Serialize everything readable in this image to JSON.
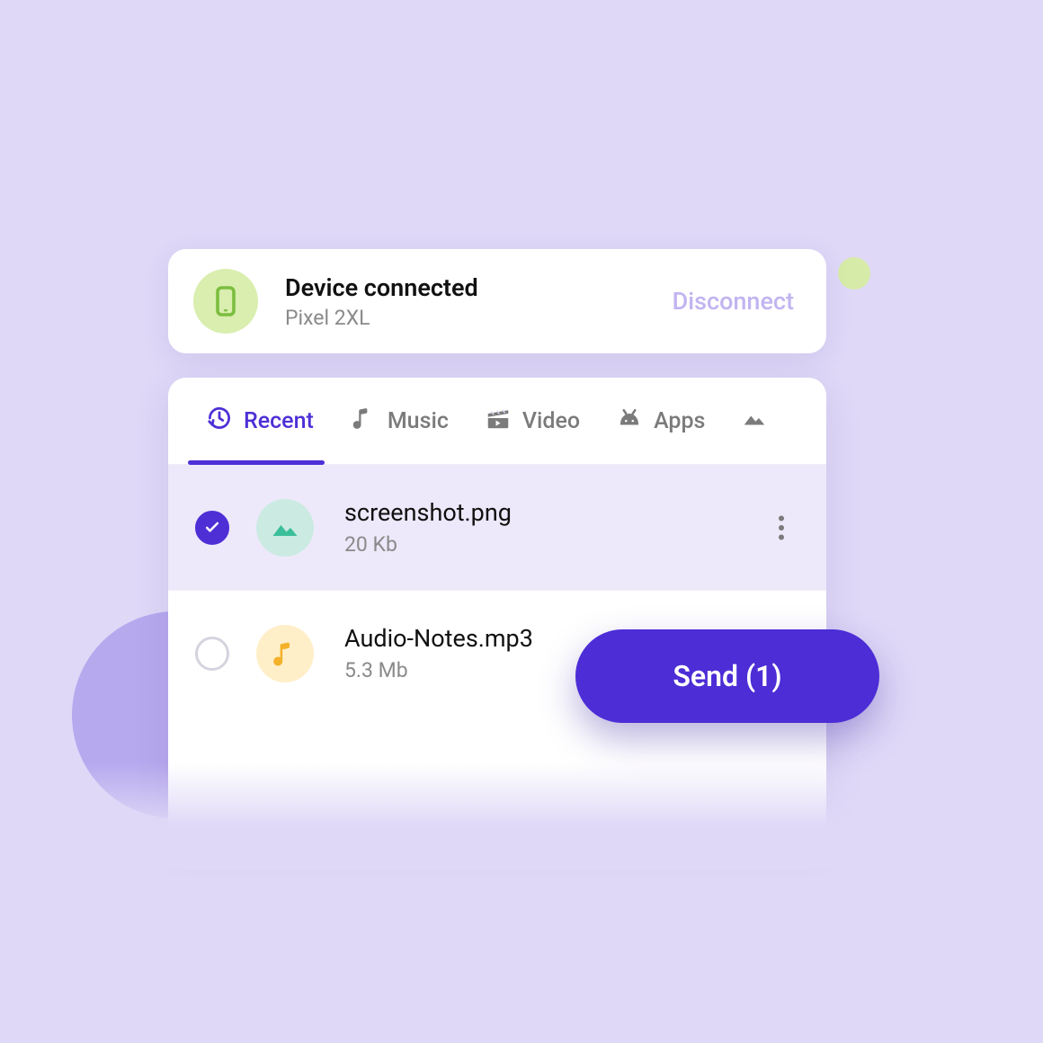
{
  "device": {
    "title": "Device connected",
    "name": "Pixel 2XL",
    "disconnect_label": "Disconnect"
  },
  "tabs": [
    {
      "label": "Recent"
    },
    {
      "label": "Music"
    },
    {
      "label": "Video"
    },
    {
      "label": "Apps"
    }
  ],
  "files": [
    {
      "name": "screenshot.png",
      "size": "20 Kb",
      "selected": true,
      "type": "image"
    },
    {
      "name": "Audio-Notes.mp3",
      "size": "5.3 Mb",
      "selected": false,
      "type": "audio"
    }
  ],
  "send_button": {
    "label": "Send (1)"
  }
}
